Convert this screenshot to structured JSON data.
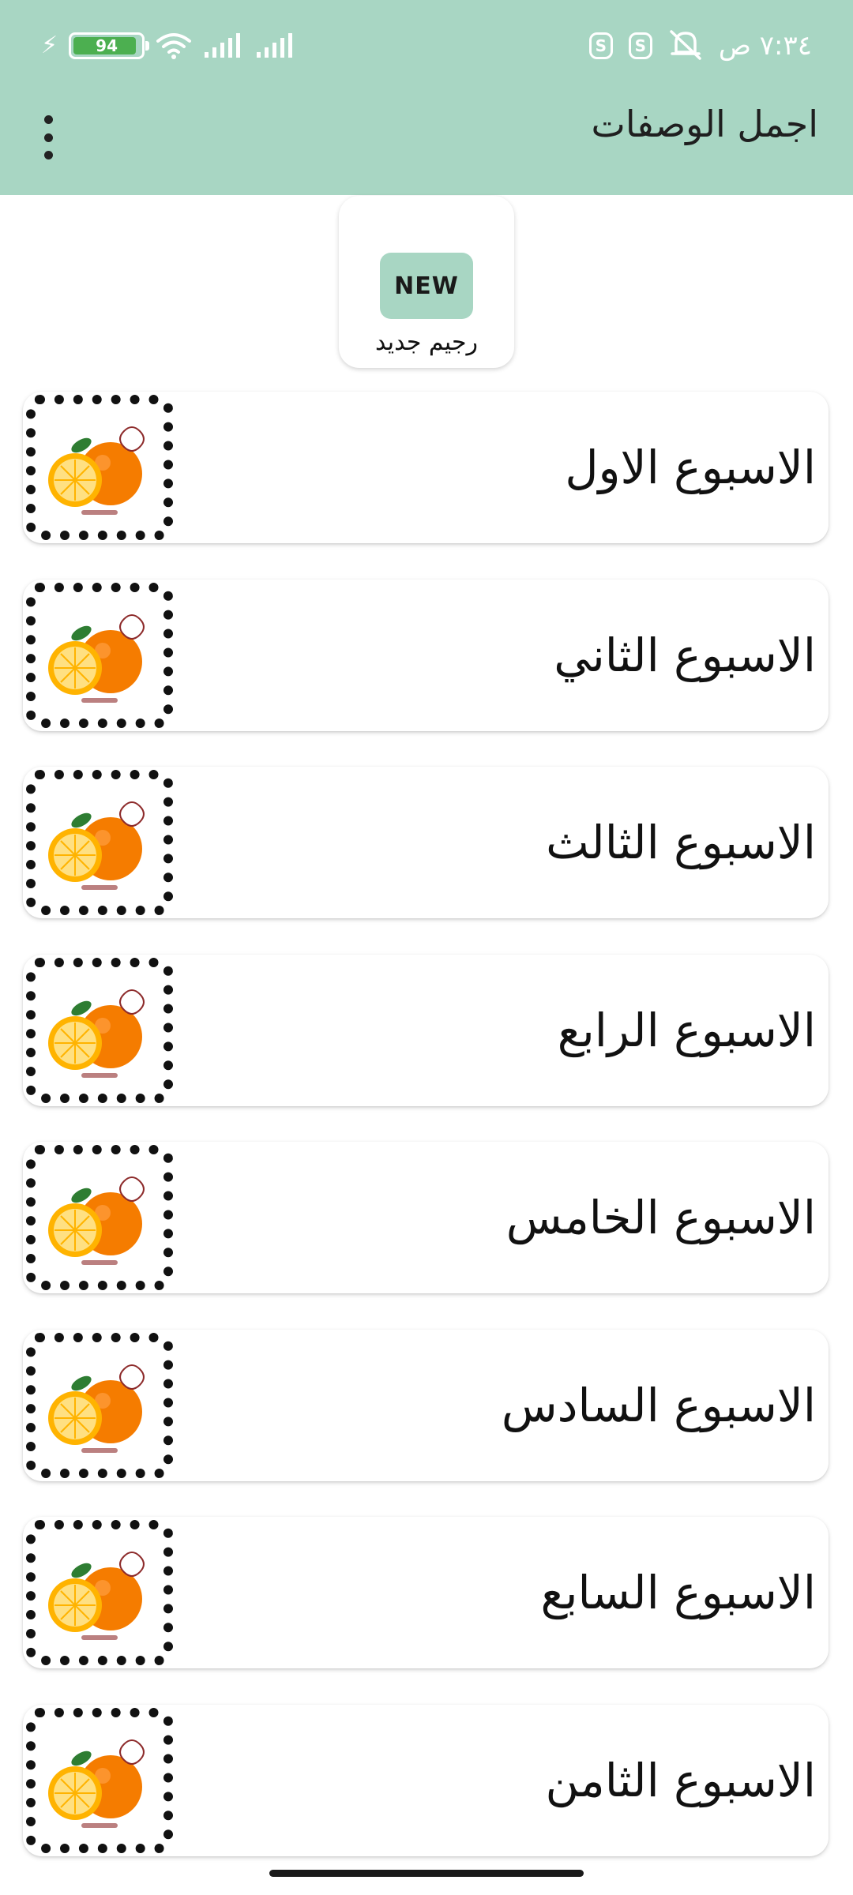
{
  "status_bar": {
    "battery_level": "94",
    "battery_fraction": 0.94,
    "time": "٧:٣٤ ص",
    "icons": [
      "charging-bolt-icon",
      "battery-icon",
      "wifi-icon",
      "signal-icon",
      "app-notification-icon",
      "mute-icon"
    ]
  },
  "appbar": {
    "title": "اجمل الوصفات",
    "menu_icon": "more-vertical-icon",
    "background": "#a8d6c3"
  },
  "new_diet": {
    "badge": "NEW",
    "label": "رجيم جديد"
  },
  "weeks": [
    {
      "title": "الاسبوع الاول"
    },
    {
      "title": "الاسبوع الثاني"
    },
    {
      "title": "الاسبوع الثالث"
    },
    {
      "title": "الاسبوع الرابع"
    },
    {
      "title": "الاسبوع الخامس"
    },
    {
      "title": "الاسبوع السادس"
    },
    {
      "title": "الاسبوع السابع"
    },
    {
      "title": "الاسبوع الثامن"
    }
  ]
}
